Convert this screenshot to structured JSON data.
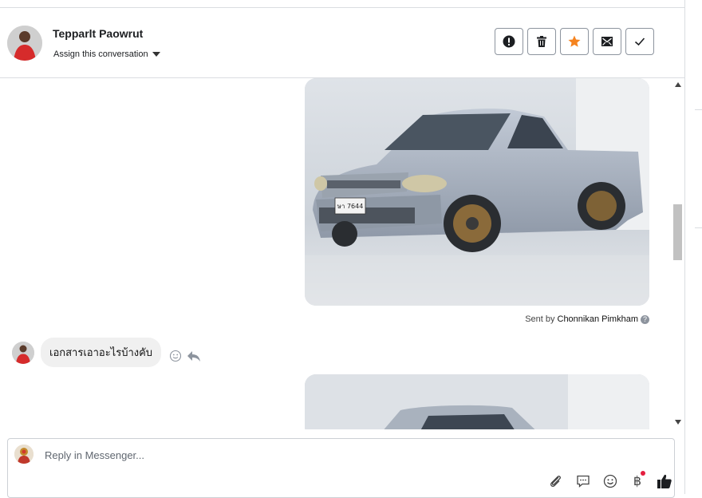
{
  "header": {
    "contact_name": "Tepparlt Paowrut",
    "assign_label": "Assign this conversation",
    "actions": [
      {
        "icon": "alert-icon"
      },
      {
        "icon": "trash-icon"
      },
      {
        "icon": "star-icon",
        "color": "#f5831f"
      },
      {
        "icon": "mark-unread-icon"
      },
      {
        "icon": "check-icon"
      }
    ]
  },
  "thread": {
    "sent_by_prefix": "Sent by",
    "sent_by_name": "Chonnikan Pimkham",
    "incoming_message": "เอกสารเอาอะไรบ้างคับ",
    "photo_plate": "ษา 7644"
  },
  "composer": {
    "placeholder": "Reply in Messenger...",
    "tools": [
      "attach-icon",
      "saved-reply-icon",
      "emoji-icon",
      "baht-icon",
      "like-icon"
    ],
    "baht_symbol": "฿",
    "like_color": "#1c1e21"
  }
}
